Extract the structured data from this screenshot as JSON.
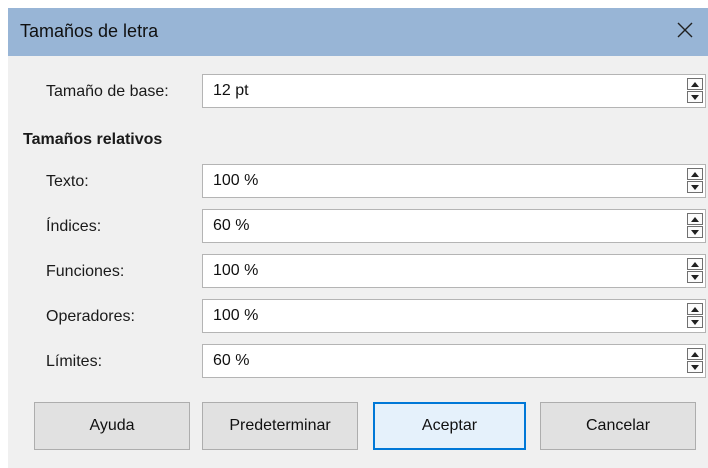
{
  "dialog": {
    "title": "Tamaños de letra",
    "close_icon": "close-icon"
  },
  "base": {
    "label": "Tamaño de base:",
    "value": "12 pt"
  },
  "relative": {
    "heading": "Tamaños relativos",
    "rows": [
      {
        "label": "Texto:",
        "value": "100 %"
      },
      {
        "label": "Índices:",
        "value": "60 %"
      },
      {
        "label": "Funciones:",
        "value": "100 %"
      },
      {
        "label": "Operadores:",
        "value": "100 %"
      },
      {
        "label": "Límites:",
        "value": "60 %"
      }
    ]
  },
  "buttons": {
    "help": "Ayuda",
    "default": "Predeterminar",
    "ok": "Aceptar",
    "cancel": "Cancelar"
  },
  "colors": {
    "titlebar": "#98b5d6",
    "focus": "#0078d7"
  }
}
